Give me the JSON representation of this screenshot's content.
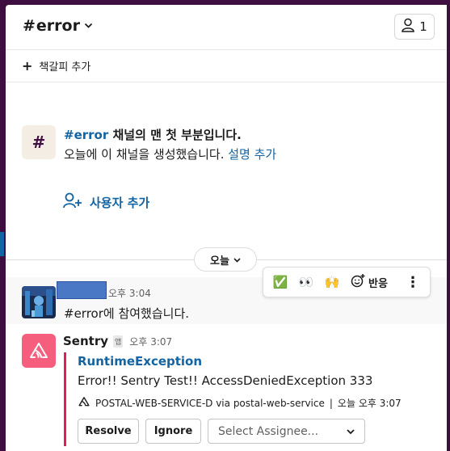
{
  "header": {
    "channel_hash": "#",
    "channel_name": "error",
    "member_count": "1"
  },
  "bookmark": {
    "add_label": "책갈피 추가"
  },
  "intro": {
    "channel_ref": "#error",
    "headline_rest": " 채널의 맨 첫 부분입니다.",
    "created_text": "오늘에 이 채널을 생성했습니다. ",
    "add_description": "설명 추가",
    "add_user": "사용자 추가"
  },
  "divider": {
    "today": "오늘"
  },
  "message1": {
    "time": "오후 3:04",
    "text": "#error에 참여했습니다."
  },
  "toolbar": {
    "emoji1": "✅",
    "emoji2": "👀",
    "emoji3": "🙌",
    "react_label": "반응",
    "more": "⋮"
  },
  "message2": {
    "sender": "Sentry",
    "app_badge": "앱",
    "time": "오후 3:07",
    "exception_title": "RuntimeException",
    "exception_message": "Error!! Sentry Test!! AccessDeniedException 333",
    "source": "POSTAL-WEB-SERVICE-D via postal-web-service",
    "separator": "|",
    "footer_time": "오늘 오후 3:07",
    "resolve": "Resolve",
    "ignore": "Ignore",
    "assignee_placeholder": "Select Assignee..."
  },
  "colors": {
    "sidebar": "#3f0e40",
    "link": "#1264a3",
    "accent_bar": "#e01e5a",
    "sentry": "#f55e7d"
  }
}
